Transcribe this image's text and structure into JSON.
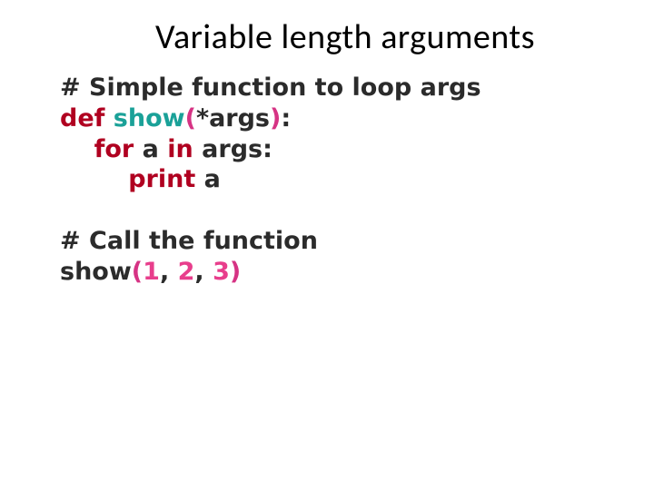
{
  "title": "Variable length arguments",
  "code": {
    "l1_hash": "# ",
    "l1_rest": "Simple function to loop args",
    "l2_def": "def",
    "l2_sp1": " ",
    "l2_name": "show",
    "l2_open": "(",
    "l2_star": "*",
    "l2_args": "args",
    "l2_close": ")",
    "l2_colon": ":",
    "l3_indent": "    ",
    "l3_for": "for",
    "l3_sp1": " ",
    "l3_a": "a",
    "l3_sp2": " ",
    "l3_in": "in",
    "l3_sp3": " ",
    "l3_args": "args",
    "l3_colon": ":",
    "l4_indent": "        ",
    "l4_print": "print",
    "l4_sp": " ",
    "l4_a": "a",
    "l5_blank": " ",
    "l6_hash": "# ",
    "l6_rest": "Call the function",
    "l7_name": "show",
    "l7_open": "(",
    "l7_n1": "1",
    "l7_c1": ",",
    "l7_sp1": " ",
    "l7_n2": "2",
    "l7_c2": ",",
    "l7_sp2": " ",
    "l7_n3": "3",
    "l7_close": ")"
  }
}
